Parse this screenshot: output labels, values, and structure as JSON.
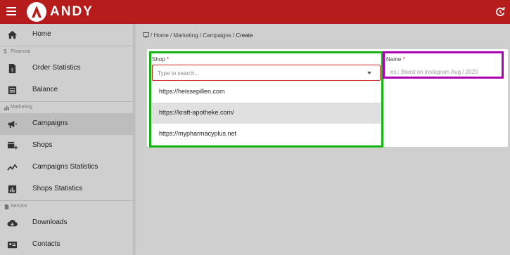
{
  "app": {
    "brand": "ANDY"
  },
  "sidebar": {
    "home": "Home",
    "sections": {
      "financial": "Financial",
      "marketing": "Marketing",
      "service": "Service"
    },
    "items": {
      "order_statistics": "Order Statistics",
      "balance": "Balance",
      "campaigns": "Campaigns",
      "shops": "Shops",
      "campaigns_statistics": "Campaigns Statistics",
      "shops_statistics": "Shops Statistics",
      "downloads": "Downloads",
      "contacts": "Contacts"
    },
    "active": "campaigns"
  },
  "breadcrumb": {
    "path": "/ Home / Marketing / Campaigns / ",
    "current": "Create"
  },
  "form": {
    "shop": {
      "label": "Shop",
      "required_mark": "*",
      "placeholder": "Type to search...",
      "options": [
        "https://heissepillen.com",
        "https://kraft-apotheke.com/",
        "https://mypharmacyplus.net"
      ],
      "highlighted_index": 1
    },
    "name": {
      "label": "Name",
      "required_mark": "*",
      "placeholder": "ex.: Boost on instagram Aug / 2020"
    }
  },
  "colors": {
    "topbar": "#b71c1c",
    "required": "#c62828",
    "highlight_green": "#12b512",
    "highlight_magenta": "#b000b5"
  }
}
